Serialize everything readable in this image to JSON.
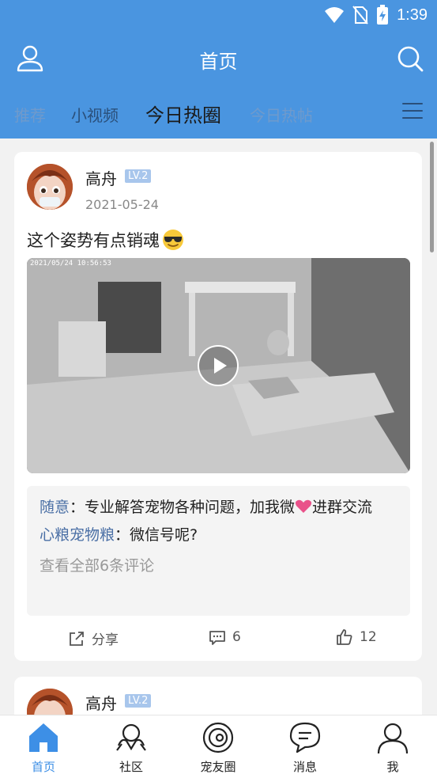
{
  "status_bar": {
    "time": "1:39"
  },
  "header": {
    "title": "首页"
  },
  "tabs": [
    {
      "label": "推荐"
    },
    {
      "label": "小视频"
    },
    {
      "label": "今日热圈"
    },
    {
      "label": "今日热帖"
    }
  ],
  "posts": [
    {
      "author": "高舟",
      "level": "LV.2",
      "date": "2021-05-24",
      "text": "这个姿势有点销魂",
      "video_timestamp": "2021/05/24 10:56:53",
      "comments": [
        {
          "user": "随意",
          "text": "：专业解答宠物各种问题，加我微",
          "text_tail": "进群交流"
        },
        {
          "user": "心粮宠物粮",
          "text": "：微信号呢?"
        }
      ],
      "view_all": "查看全部6条评论",
      "share_label": "分享",
      "comment_count": "6",
      "like_count": "12"
    },
    {
      "author": "高舟",
      "level": "LV.2"
    }
  ],
  "bottom_nav": [
    {
      "label": "首页"
    },
    {
      "label": "社区"
    },
    {
      "label": "宠友圈"
    },
    {
      "label": "消息"
    },
    {
      "label": "我"
    }
  ],
  "colors": {
    "primary": "#4a95e0",
    "accent": "#3d8fe6",
    "link": "#4a6fa5"
  }
}
